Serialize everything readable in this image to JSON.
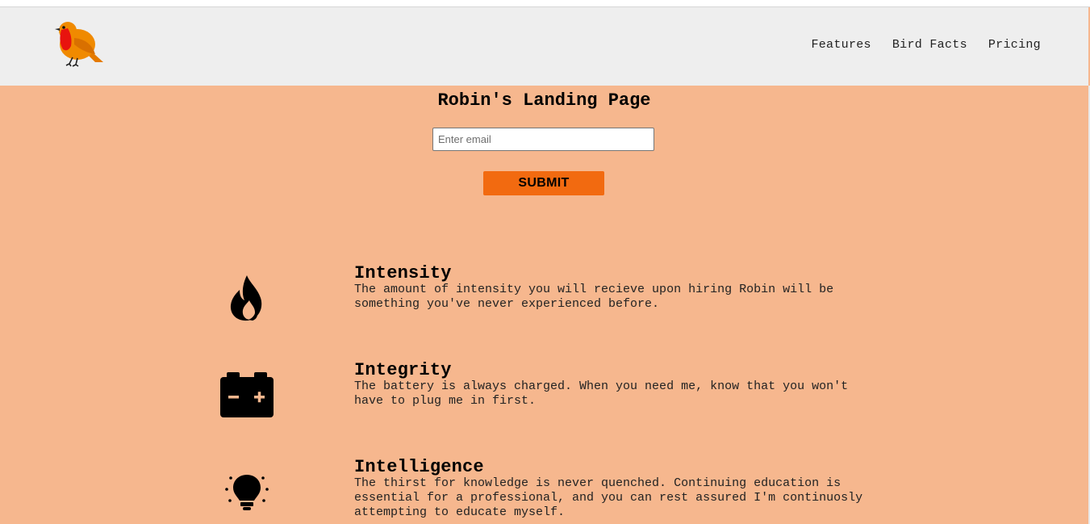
{
  "nav": {
    "items": [
      "Features",
      "Bird Facts",
      "Pricing"
    ]
  },
  "hero": {
    "title": "Robin's Landing Page",
    "email_placeholder": "Enter email",
    "submit_label": "SUBMIT"
  },
  "features": [
    {
      "icon": "fire-icon",
      "title": "Intensity",
      "text": "The amount of intensity you will recieve upon hiring Robin will be something you've never experienced before."
    },
    {
      "icon": "battery-icon",
      "title": "Integrity",
      "text": "The battery is always charged. When you need me, know that you won't have to plug me in first."
    },
    {
      "icon": "lightbulb-icon",
      "title": "Intelligence",
      "text": "The thirst for knowledge is never quenched. Continuing education is essential for a professional, and you can rest assured I'm continuosly attempting to educate myself."
    }
  ],
  "colors": {
    "page_background": "#f6b78e",
    "header_background": "#eeeeee",
    "accent": "#f26a10"
  }
}
